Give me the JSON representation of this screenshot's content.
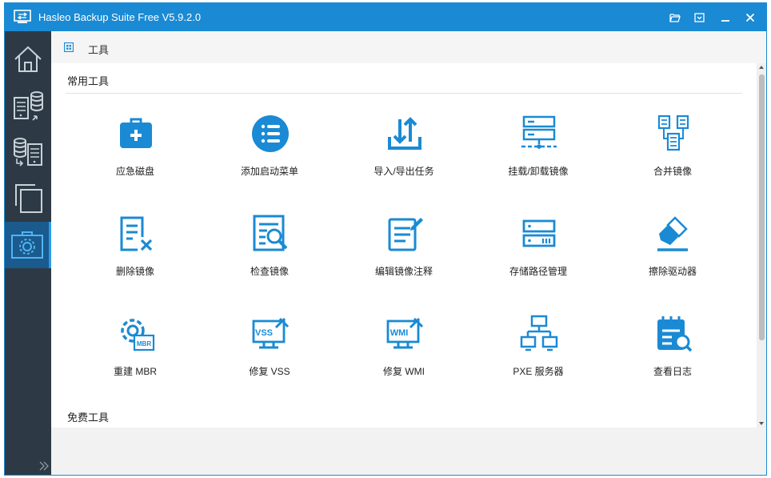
{
  "window": {
    "title": "Hasleo Backup Suite Free V5.9.2.0",
    "accent_color": "#1a8ad4",
    "sidebar_color": "#2d3a45"
  },
  "titlebar": {
    "buttons": [
      "folder-open-icon",
      "menu-icon",
      "minimize-icon",
      "close-icon"
    ]
  },
  "sidebar": {
    "items": [
      {
        "icon": "home-icon",
        "active": false
      },
      {
        "icon": "backup-icon",
        "active": false
      },
      {
        "icon": "restore-icon",
        "active": false
      },
      {
        "icon": "clone-icon",
        "active": false
      },
      {
        "icon": "tools-icon",
        "active": true
      }
    ],
    "expand_icon": "double-chevron-right-icon"
  },
  "breadcrumb": {
    "icon": "grid-icon",
    "label": "工具"
  },
  "sections": {
    "common": "常用工具",
    "free": "免费工具"
  },
  "tools": [
    {
      "label": "应急磁盘",
      "icon": "first-aid-kit-icon"
    },
    {
      "label": "添加启动菜单",
      "icon": "boot-menu-icon"
    },
    {
      "label": "导入/导出任务",
      "icon": "import-export-icon"
    },
    {
      "label": "挂载/卸载镜像",
      "icon": "mount-image-icon"
    },
    {
      "label": "合并镜像",
      "icon": "merge-image-icon"
    },
    {
      "label": "删除镜像",
      "icon": "delete-image-icon"
    },
    {
      "label": "检查镜像",
      "icon": "check-image-icon"
    },
    {
      "label": "编辑镜像注释",
      "icon": "edit-comment-icon"
    },
    {
      "label": "存储路径管理",
      "icon": "storage-path-icon"
    },
    {
      "label": "擦除驱动器",
      "icon": "eraser-icon"
    },
    {
      "label": "重建 MBR",
      "icon": "rebuild-mbr-icon"
    },
    {
      "label": "修复 VSS",
      "icon": "repair-vss-icon"
    },
    {
      "label": "修复 WMI",
      "icon": "repair-wmi-icon"
    },
    {
      "label": "PXE 服务器",
      "icon": "pxe-server-icon"
    },
    {
      "label": "查看日志",
      "icon": "view-log-icon"
    }
  ]
}
